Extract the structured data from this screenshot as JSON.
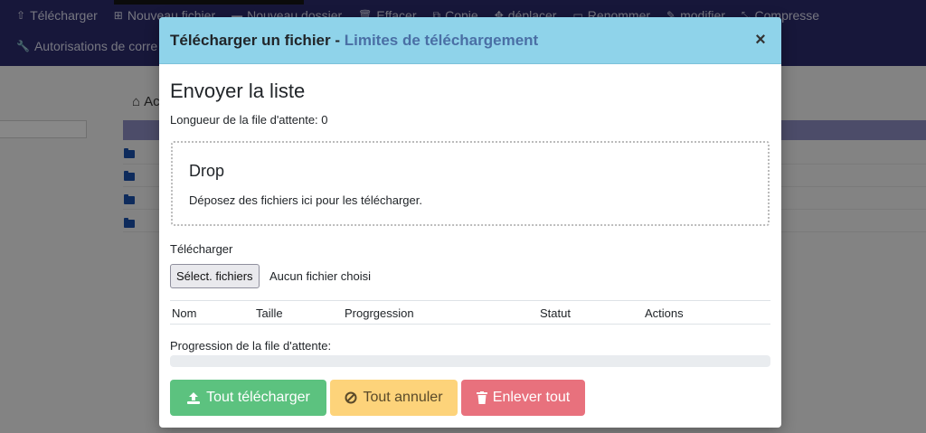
{
  "toolbar": {
    "row1": [
      {
        "icon": "upload-icon",
        "glyph": "⇧",
        "label": "Télécharger"
      },
      {
        "icon": "plus-square-icon",
        "glyph": "⊞",
        "label": "Nouveau fichier"
      },
      {
        "icon": "folder-icon",
        "glyph": "▬",
        "label": "Nouveau dossier"
      },
      {
        "icon": "trash-icon",
        "glyph": "🗑",
        "label": "Effacer"
      },
      {
        "icon": "copy-icon",
        "glyph": "⧉",
        "label": "Copie"
      },
      {
        "icon": "arrows-icon",
        "glyph": "✥",
        "label": "déplacer"
      },
      {
        "icon": "rename-icon",
        "glyph": "▭",
        "label": "Renommer"
      },
      {
        "icon": "edit-icon",
        "glyph": "✎",
        "label": "modifier"
      },
      {
        "icon": "compress-icon",
        "glyph": "⤡",
        "label": "Compresse"
      }
    ],
    "row2": [
      {
        "icon": "wrench-icon",
        "glyph": "🔧",
        "label": "Autorisations de corre"
      }
    ]
  },
  "background": {
    "home_label": "Ac"
  },
  "modal": {
    "title_main": "Télécharger un fichier - ",
    "title_limits": "Limites de téléchargement",
    "close_glyph": "×",
    "heading": "Envoyer la liste",
    "queue_length": "Longueur de la file d'attente: 0",
    "drop": {
      "title": "Drop",
      "text": "Déposez des fichiers ici pour les télécharger."
    },
    "upload_label": "Télécharger",
    "file_button": "Sélect. fichiers",
    "file_none": "Aucun fichier choisi",
    "table_headers": [
      "Nom",
      "Taille",
      "Progrgession",
      "Statut",
      "Actions"
    ],
    "queue_progress_label": "Progression de la file d'attente:",
    "queue_progress_percent": 0,
    "buttons": {
      "upload_all": "Tout télécharger",
      "cancel_all": "Tout annuler",
      "remove_all": "Enlever tout"
    }
  },
  "colors": {
    "topbar": "#2a2a6a",
    "modal_header": "#8fd3ea",
    "success": "#5cc27f",
    "warning": "#fdd37a",
    "danger": "#e8717d"
  }
}
